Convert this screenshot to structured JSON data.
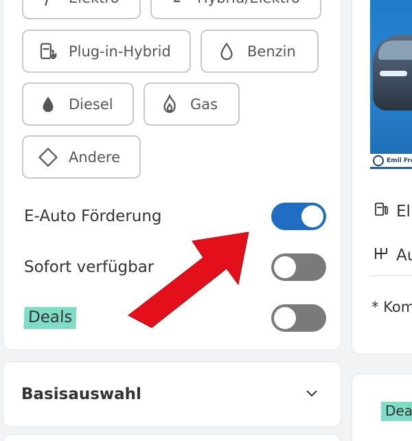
{
  "fuel_chips": [
    {
      "label": "Elektro",
      "icon": "plug-icon"
    },
    {
      "label": "Hybrid/Elektro",
      "icon": "hybrid-icon"
    },
    {
      "label": "Plug-in-Hybrid",
      "icon": "fuel-pump-icon"
    },
    {
      "label": "Benzin",
      "icon": "drop-outline-icon"
    },
    {
      "label": "Diesel",
      "icon": "drop-filled-icon"
    },
    {
      "label": "Gas",
      "icon": "flame-icon"
    },
    {
      "label": "Andere",
      "icon": "diamond-icon"
    }
  ],
  "toggles": [
    {
      "label": "E-Auto Förderung",
      "on": true
    },
    {
      "label": "Sofort verfügbar",
      "on": false
    },
    {
      "label": "Deals",
      "on": false
    }
  ],
  "accordion": {
    "title": "Basisauswahl",
    "icon": "chevron-down-icon"
  },
  "card": {
    "logo_text": "Emil Frey",
    "spec_fuel": "El",
    "spec_gearbox": "Au",
    "footnote": "* Kom"
  },
  "card2": {
    "badge": "Dea"
  },
  "colors": {
    "accent": "#1f6ec4",
    "toggle_off": "#7a7a7a",
    "highlight": "#7fdcc7",
    "arrow": "#e3101b"
  }
}
